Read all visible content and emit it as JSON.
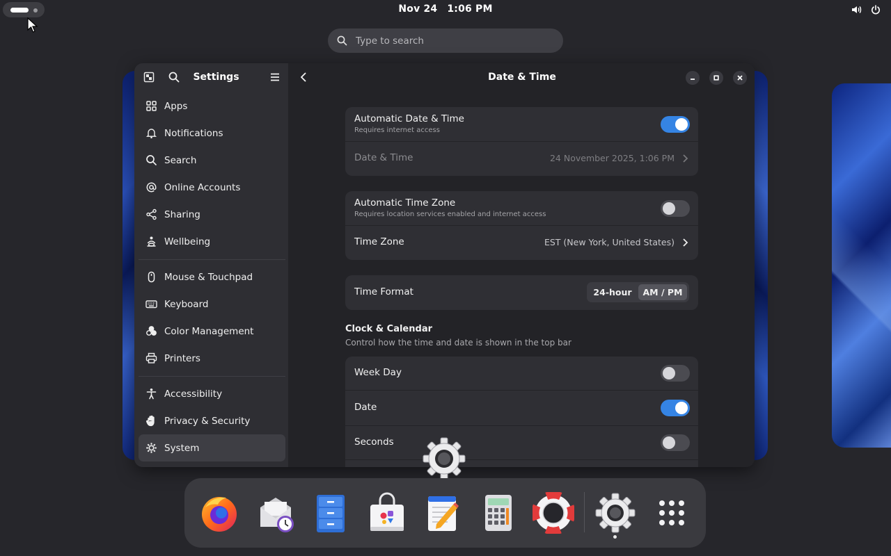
{
  "topbar": {
    "clock_date": "Nov 24",
    "clock_time": "1:06 PM",
    "icons": [
      "activities-indicator",
      "volume-icon",
      "power-icon"
    ]
  },
  "overview_search": {
    "placeholder": "Type to search"
  },
  "settings_window": {
    "sidebar": {
      "title": "Settings",
      "items": [
        {
          "label": "Apps",
          "icon": "apps-icon"
        },
        {
          "label": "Notifications",
          "icon": "bell-icon"
        },
        {
          "label": "Search",
          "icon": "search-icon"
        },
        {
          "label": "Online Accounts",
          "icon": "at-icon"
        },
        {
          "label": "Sharing",
          "icon": "share-icon"
        },
        {
          "label": "Wellbeing",
          "icon": "wellbeing-icon"
        },
        {
          "label": "Mouse & Touchpad",
          "icon": "mouse-icon"
        },
        {
          "label": "Keyboard",
          "icon": "keyboard-icon"
        },
        {
          "label": "Color Management",
          "icon": "color-icon"
        },
        {
          "label": "Printers",
          "icon": "printer-icon"
        },
        {
          "label": "Accessibility",
          "icon": "accessibility-icon"
        },
        {
          "label": "Privacy & Security",
          "icon": "hand-icon"
        },
        {
          "label": "System",
          "icon": "gear-icon",
          "active": true
        }
      ]
    },
    "page": {
      "title": "Date & Time",
      "auto_datetime": {
        "title": "Automatic Date & Time",
        "subtitle": "Requires internet access",
        "enabled": true
      },
      "datetime": {
        "title": "Date & Time",
        "value": "24 November 2025,  1:06 PM"
      },
      "auto_timezone": {
        "title": "Automatic Time Zone",
        "subtitle": "Requires location services enabled and internet access",
        "enabled": false
      },
      "timezone": {
        "title": "Time Zone",
        "value": "EST (New York, United States)"
      },
      "time_format": {
        "title": "Time Format",
        "options": [
          "24-hour",
          "AM / PM"
        ],
        "selected": "AM / PM"
      },
      "clock_calendar": {
        "heading": "Clock & Calendar",
        "description": "Control how the time and date is shown in the top bar",
        "week_day": {
          "title": "Week Day",
          "enabled": false
        },
        "date": {
          "title": "Date",
          "enabled": true
        },
        "seconds": {
          "title": "Seconds",
          "enabled": false
        }
      }
    }
  },
  "dock": {
    "apps": [
      "Firefox",
      "Evolution",
      "Files",
      "Software",
      "Text Editor",
      "Calculator",
      "Help",
      "Settings",
      "Show Apps"
    ]
  },
  "colors": {
    "accent": "#3584e4",
    "window_bg": "#232327",
    "sidebar_bg": "#2e2e33",
    "card_bg": "#2f2f34"
  }
}
